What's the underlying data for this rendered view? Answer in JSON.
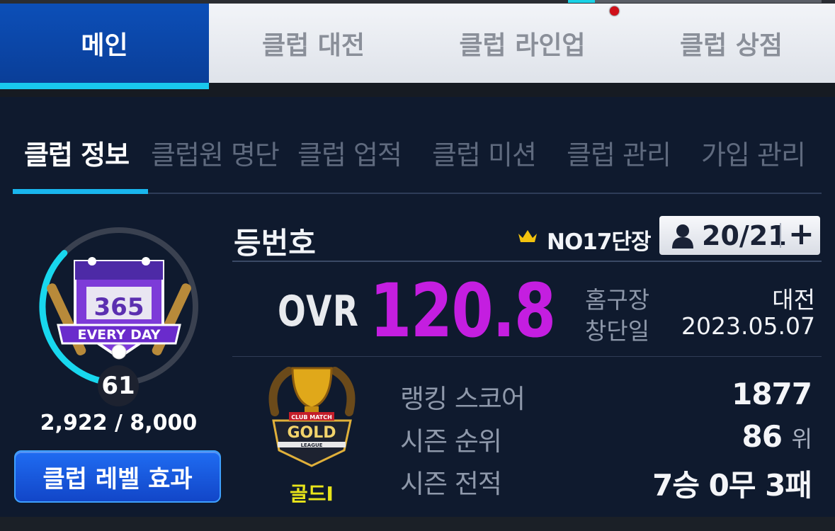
{
  "main_tabs": [
    {
      "label": "메인",
      "active": true
    },
    {
      "label": "클럽 대전",
      "active": false
    },
    {
      "label": "클럽 라인업",
      "active": false
    },
    {
      "label": "클럽 상점",
      "active": false
    }
  ],
  "sub_tabs": [
    {
      "label": "클럽 정보",
      "active": true
    },
    {
      "label": "클럽원 명단",
      "active": false
    },
    {
      "label": "클럽 업적",
      "active": false
    },
    {
      "label": "클럽 미션",
      "active": false
    },
    {
      "label": "클럽 관리",
      "active": false
    },
    {
      "label": "가입 관리",
      "active": false
    }
  ],
  "emblem": {
    "number_text": "365",
    "banner_text": "EVERY DAY"
  },
  "club": {
    "level": "61",
    "xp_text": "2,922 / 8,000",
    "xp_progress": 0.3653,
    "level_effect_button": "클럽 레벨 효과",
    "name": "등번호",
    "captain": "NO17단장",
    "members": "20/21",
    "add_member": "+",
    "ovr_label": "OVR",
    "ovr_value": "120.8",
    "home_label": "홈구장",
    "home_value": "대전",
    "founded_label": "창단일",
    "founded_value": "2023.05.07"
  },
  "league": {
    "name": "골드I",
    "badge_top": "CLUB MATCH",
    "badge_main": "GOLD",
    "badge_sub": "LEAGUE"
  },
  "stats": {
    "ranking_label": "랭킹 스코어",
    "ranking_value": "1877",
    "season_rank_label": "시즌 순위",
    "season_rank_value": "86",
    "season_rank_unit": "위",
    "season_record_label": "시즌 전적",
    "season_record_value": "7승 0무 3패"
  },
  "colors": {
    "accent_blue": "#0c4fb8",
    "cyan": "#19c8ee",
    "ovr": "#c41ee0",
    "gold_text": "#e8e41a",
    "panel": "#0f1a2e"
  }
}
